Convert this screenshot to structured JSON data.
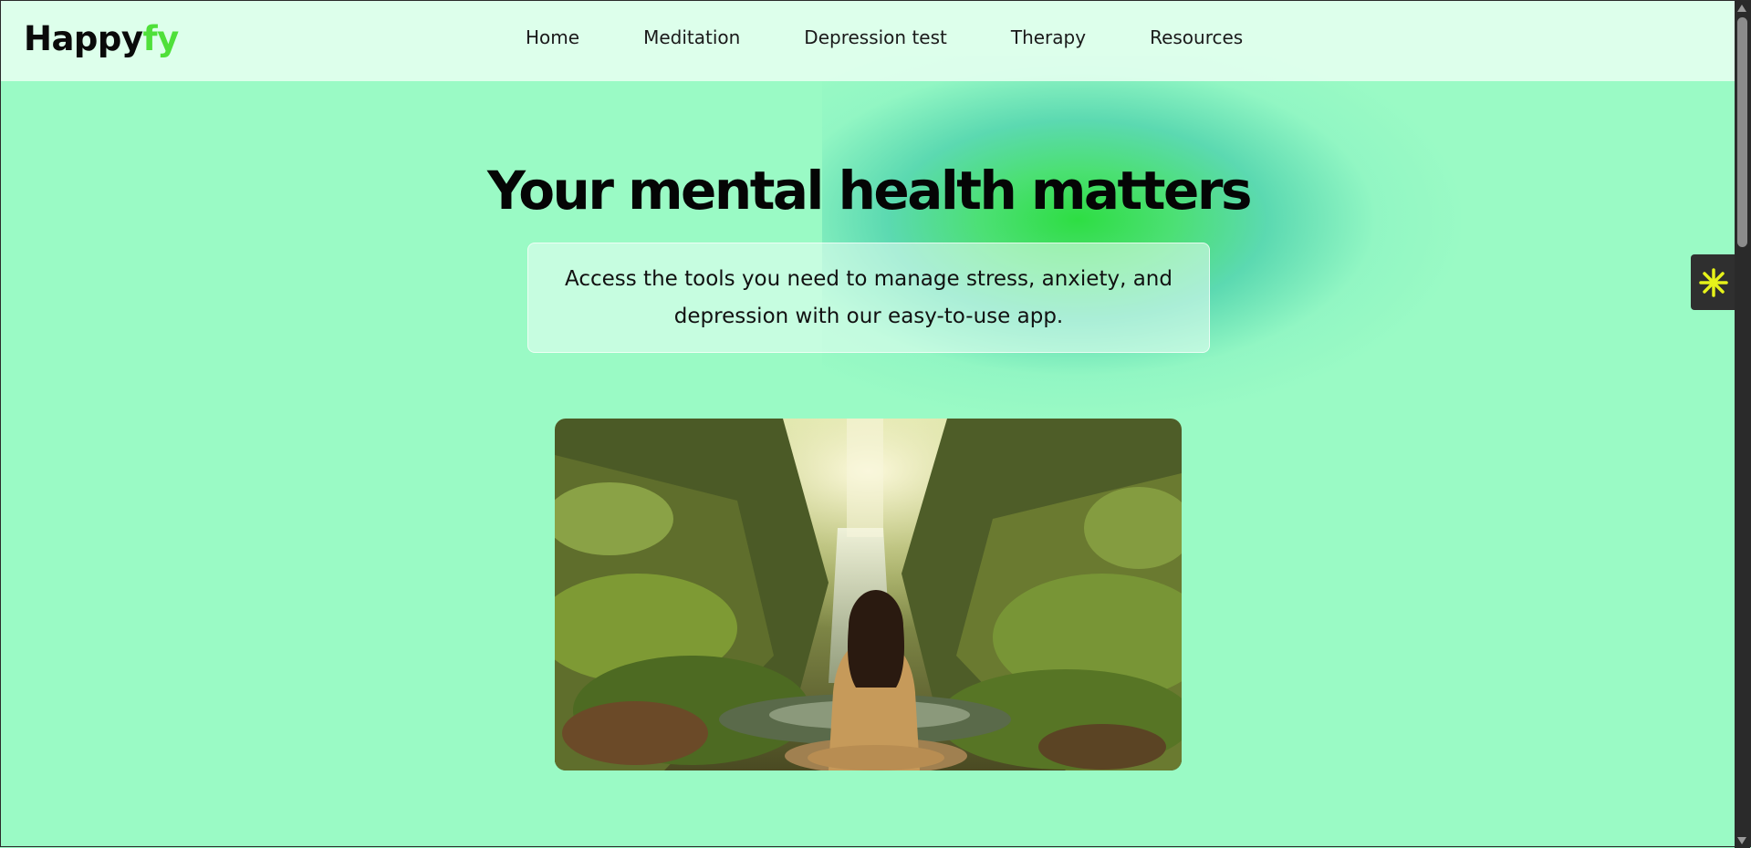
{
  "brand": {
    "name_main": "Happy",
    "name_accent": "fy",
    "accent_color": "#4fe03a"
  },
  "nav": {
    "items": [
      {
        "label": "Home"
      },
      {
        "label": "Meditation"
      },
      {
        "label": "Depression test"
      },
      {
        "label": "Therapy"
      },
      {
        "label": "Resources"
      }
    ]
  },
  "hero": {
    "title": "Your mental health matters",
    "description": "Access the tools you need to manage stress, anxiety, and depression with our easy-to-use app.",
    "image_icon": "meditation-waterfall-illustration"
  },
  "widget": {
    "icon": "asterisk-sparkle-icon",
    "icon_color": "#e6f21a"
  },
  "colors": {
    "background": "#9afac5",
    "navbar": "#e6fff0"
  }
}
